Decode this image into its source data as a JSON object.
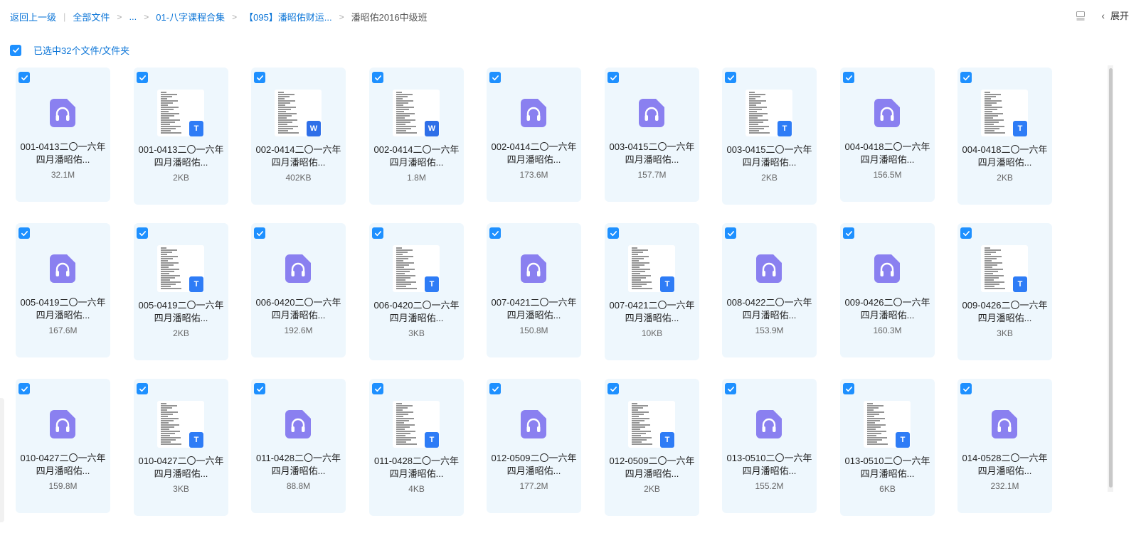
{
  "breadcrumb": {
    "back": "返回上一级",
    "all_files": "全部文件",
    "ellipsis": "...",
    "folder1": "01-八字课程合集",
    "folder2": "【095】潘昭佑财运...",
    "current": "潘昭佑2016中级班"
  },
  "top_right": {
    "expand": "展开",
    "icons": [
      "view-toggle-icon",
      "chevron-left-icon"
    ]
  },
  "selection": {
    "text": "已选中32个文件/文件夹",
    "all_checked": true
  },
  "colors": {
    "accent": "#1e90ff",
    "link": "#0a74d7",
    "card_bg": "#eef7fd",
    "audio_icon": "#8a80f0"
  },
  "files": [
    {
      "type": "audio",
      "name": "001-0413二〇一六年四月潘昭佑...",
      "size": "32.1M"
    },
    {
      "type": "txt",
      "name": "001-0413二〇一六年四月潘昭佑...",
      "size": "2KB"
    },
    {
      "type": "word",
      "name": "002-0414二〇一六年四月潘昭佑...",
      "size": "402KB"
    },
    {
      "type": "word",
      "name": "002-0414二〇一六年四月潘昭佑...",
      "size": "1.8M"
    },
    {
      "type": "audio",
      "name": "002-0414二〇一六年四月潘昭佑...",
      "size": "173.6M"
    },
    {
      "type": "audio",
      "name": "003-0415二〇一六年四月潘昭佑...",
      "size": "157.7M"
    },
    {
      "type": "txt",
      "name": "003-0415二〇一六年四月潘昭佑...",
      "size": "2KB"
    },
    {
      "type": "audio",
      "name": "004-0418二〇一六年四月潘昭佑...",
      "size": "156.5M"
    },
    {
      "type": "txt",
      "name": "004-0418二〇一六年四月潘昭佑...",
      "size": "2KB"
    },
    {
      "type": "audio",
      "name": "005-0419二〇一六年四月潘昭佑...",
      "size": "167.6M"
    },
    {
      "type": "txt",
      "name": "005-0419二〇一六年四月潘昭佑...",
      "size": "2KB"
    },
    {
      "type": "audio",
      "name": "006-0420二〇一六年四月潘昭佑...",
      "size": "192.6M"
    },
    {
      "type": "txt",
      "name": "006-0420二〇一六年四月潘昭佑...",
      "size": "3KB"
    },
    {
      "type": "audio",
      "name": "007-0421二〇一六年四月潘昭佑...",
      "size": "150.8M"
    },
    {
      "type": "txt",
      "name": "007-0421二〇一六年四月潘昭佑...",
      "size": "10KB"
    },
    {
      "type": "audio",
      "name": "008-0422二〇一六年四月潘昭佑...",
      "size": "153.9M"
    },
    {
      "type": "audio",
      "name": "009-0426二〇一六年四月潘昭佑...",
      "size": "160.3M"
    },
    {
      "type": "txt",
      "name": "009-0426二〇一六年四月潘昭佑...",
      "size": "3KB"
    },
    {
      "type": "audio",
      "name": "010-0427二〇一六年四月潘昭佑...",
      "size": "159.8M"
    },
    {
      "type": "txt",
      "name": "010-0427二〇一六年四月潘昭佑...",
      "size": "3KB"
    },
    {
      "type": "audio",
      "name": "011-0428二〇一六年四月潘昭佑...",
      "size": "88.8M"
    },
    {
      "type": "txt",
      "name": "011-0428二〇一六年四月潘昭佑...",
      "size": "4KB"
    },
    {
      "type": "audio",
      "name": "012-0509二〇一六年四月潘昭佑...",
      "size": "177.2M"
    },
    {
      "type": "txt",
      "name": "012-0509二〇一六年四月潘昭佑...",
      "size": "2KB"
    },
    {
      "type": "audio",
      "name": "013-0510二〇一六年四月潘昭佑...",
      "size": "155.2M"
    },
    {
      "type": "txt",
      "name": "013-0510二〇一六年四月潘昭佑...",
      "size": "6KB"
    },
    {
      "type": "audio",
      "name": "014-0528二〇一六年四月潘昭佑...",
      "size": "232.1M"
    }
  ]
}
